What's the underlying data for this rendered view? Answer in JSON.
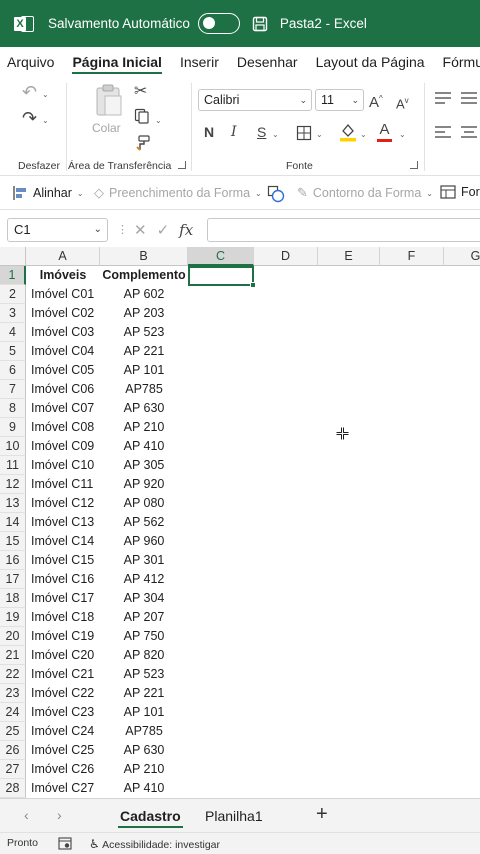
{
  "titlebar": {
    "autosave_label": "Salvamento Automático",
    "doc_title": "Pasta2  -  Excel",
    "brand_color": "#1e7145"
  },
  "ribbon_tabs": [
    "Arquivo",
    "Página Inicial",
    "Inserir",
    "Desenhar",
    "Layout da Página",
    "Fórmulas"
  ],
  "active_tab": "Página Inicial",
  "ribbon": {
    "undo_group_label": "Desfazer",
    "clipboard": {
      "paste_label": "Colar",
      "group_label": "Área de Transferência"
    },
    "font": {
      "family": "Calibri",
      "size": "11",
      "group_label": "Fonte",
      "bold": "N",
      "italic": "I",
      "underline": "S",
      "font_color_letter": "A"
    }
  },
  "toolbar2": {
    "align": "Alinhar",
    "fill": "Preenchimento da Forma",
    "outline": "Contorno da Forma",
    "format": "For"
  },
  "formula_bar": {
    "name_box": "C1",
    "fx": "fx",
    "content": ""
  },
  "grid": {
    "columns": [
      "A",
      "B",
      "C",
      "D",
      "E",
      "F",
      "G"
    ],
    "selected_column": "C",
    "selected_row": "1",
    "header_row": {
      "n": "1",
      "a": "Imóveis",
      "b": "Complemento"
    },
    "rows": [
      {
        "n": "2",
        "a": "Imóvel C01",
        "b": "AP 602"
      },
      {
        "n": "3",
        "a": "Imóvel C02",
        "b": "AP 203"
      },
      {
        "n": "4",
        "a": "Imóvel C03",
        "b": "AP 523"
      },
      {
        "n": "5",
        "a": "Imóvel C04",
        "b": "AP 221"
      },
      {
        "n": "6",
        "a": "Imóvel C05",
        "b": "AP 101"
      },
      {
        "n": "7",
        "a": "Imóvel C06",
        "b": "AP785"
      },
      {
        "n": "8",
        "a": "Imóvel C07",
        "b": "AP 630"
      },
      {
        "n": "9",
        "a": "Imóvel C08",
        "b": "AP 210"
      },
      {
        "n": "10",
        "a": "Imóvel C09",
        "b": "AP 410"
      },
      {
        "n": "11",
        "a": "Imóvel C10",
        "b": "AP 305"
      },
      {
        "n": "12",
        "a": "Imóvel C11",
        "b": "AP 920"
      },
      {
        "n": "13",
        "a": "Imóvel C12",
        "b": "AP 080"
      },
      {
        "n": "14",
        "a": "Imóvel C13",
        "b": "AP 562"
      },
      {
        "n": "15",
        "a": "Imóvel C14",
        "b": "AP 960"
      },
      {
        "n": "16",
        "a": "Imóvel C15",
        "b": "AP 301"
      },
      {
        "n": "17",
        "a": "Imóvel C16",
        "b": "AP 412"
      },
      {
        "n": "18",
        "a": "Imóvel C17",
        "b": "AP 304"
      },
      {
        "n": "19",
        "a": "Imóvel C18",
        "b": "AP 207"
      },
      {
        "n": "20",
        "a": "Imóvel C19",
        "b": "AP 750"
      },
      {
        "n": "21",
        "a": "Imóvel C20",
        "b": "AP 820"
      },
      {
        "n": "22",
        "a": "Imóvel C21",
        "b": "AP 523"
      },
      {
        "n": "23",
        "a": "Imóvel C22",
        "b": "AP 221"
      },
      {
        "n": "24",
        "a": "Imóvel C23",
        "b": "AP 101"
      },
      {
        "n": "25",
        "a": "Imóvel C24",
        "b": "AP785"
      },
      {
        "n": "26",
        "a": "Imóvel C25",
        "b": "AP 630"
      },
      {
        "n": "27",
        "a": "Imóvel C26",
        "b": "AP 210"
      },
      {
        "n": "28",
        "a": "Imóvel C27",
        "b": "AP 410"
      }
    ]
  },
  "sheets": {
    "tabs": [
      "Cadastro",
      "Planilha1"
    ],
    "active": "Cadastro",
    "add_label": "+"
  },
  "statusbar": {
    "ready": "Pronto",
    "accessibility": "Acessibilidade: investigar"
  }
}
